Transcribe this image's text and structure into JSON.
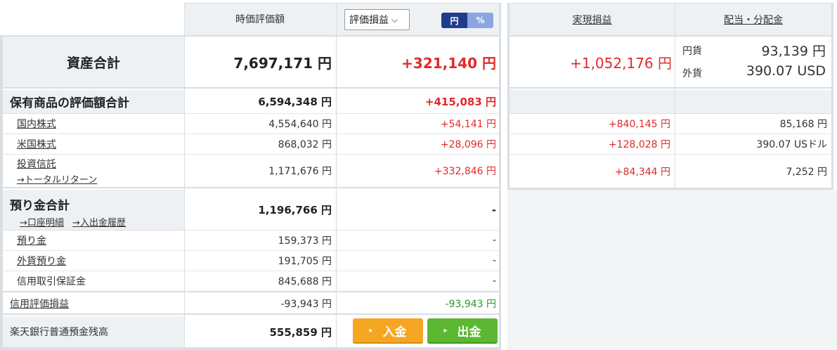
{
  "header": {
    "valuation_col": "時価評価額",
    "gain_select": "評価損益",
    "toggle_yen": "円",
    "toggle_pct": "%",
    "realized_col": "実現損益",
    "dividend_col": "配当・分配金"
  },
  "total_assets": {
    "label": "資産合計",
    "valuation": "7,697,171 円",
    "gain": "+321,140 円",
    "realized": "+1,052,176 円",
    "div_yen_label": "円貨",
    "div_yen_value": "93,139 円",
    "div_fx_label": "外貨",
    "div_fx_value": "390.07 USD"
  },
  "holdings": {
    "label": "保有商品の評価額合計",
    "valuation": "6,594,348 円",
    "gain": "+415,083 円",
    "rows": [
      {
        "label": "国内株式",
        "valuation": "4,554,640 円",
        "gain": "+54,141 円",
        "realized": "+840,145 円",
        "dividend": "85,168 円"
      },
      {
        "label": "米国株式",
        "valuation": "868,032 円",
        "gain": "+28,096 円",
        "realized": "+128,028 円",
        "dividend": "390.07 USドル"
      },
      {
        "label": "投資信託",
        "sublink": "→トータルリターン",
        "valuation": "1,171,676 円",
        "gain": "+332,846 円",
        "realized": "+84,344 円",
        "dividend": "7,252 円"
      }
    ]
  },
  "deposits": {
    "label": "預り金合計",
    "link1": "→口座明細",
    "link2": "→入出金履歴",
    "valuation": "1,196,766 円",
    "gain": "-",
    "rows": [
      {
        "label": "預り金",
        "valuation": "159,373 円",
        "gain": "-"
      },
      {
        "label": "外貨預り金",
        "valuation": "191,705 円",
        "gain": "-"
      },
      {
        "label": "信用取引保証金",
        "valuation": "845,688 円",
        "gain": "-"
      }
    ]
  },
  "margin": {
    "label": "信用評価損益",
    "valuation": "-93,943 円",
    "gain": "-93,943 円"
  },
  "bank": {
    "label": "楽天銀行普通預金残高",
    "valuation": "555,859 円",
    "deposit_btn": "入金",
    "withdraw_btn": "出金"
  },
  "colors": {
    "positive": "#e02a2a",
    "negative": "#2a9a2a",
    "header_bg": "#eef1f4",
    "deposit_btn": "#f5a623",
    "withdraw_btn": "#5cb832",
    "toggle_active": "#1f3d8c"
  }
}
